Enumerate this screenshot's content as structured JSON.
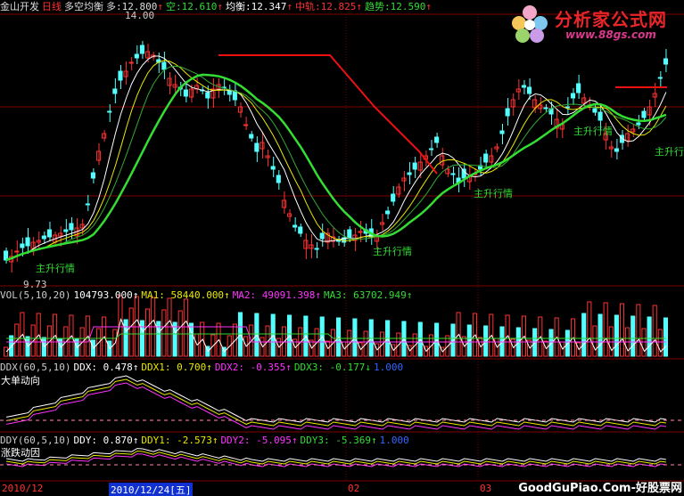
{
  "header": {
    "stock_name": "金山开发",
    "period": "日线",
    "indicator": "多空均衡",
    "bull_label": "多:",
    "bull_value": "12.800",
    "bear_label": "空:",
    "bear_value": "12.610",
    "balance_label": "均衡:",
    "balance_value": "12.347",
    "mid_label": "中轨:",
    "mid_value": "12.825",
    "trend_label": "趋势:",
    "trend_value": "12.590",
    "up_arrow": "↑"
  },
  "main_chart": {
    "high_price": "14.00",
    "low_price": "9.73",
    "annotations": [
      "主升行情",
      "主升行情",
      "主升行情",
      "主升行情",
      "主升行情"
    ]
  },
  "vol_panel": {
    "title": "VOL(5,10,20)",
    "value": "104793.000↑",
    "ma1": "MA1: 58440.000↑",
    "ma2": "MA2: 49091.398↑",
    "ma3": "MA3: 63702.949↑"
  },
  "ddx_panel": {
    "title": "DDX(60,5,10)",
    "ddx": "DDX: 0.478↑",
    "ddx1": "DDX1: 0.700↑",
    "ddx2": "DDX2: -0.355↑",
    "ddx3": "DDX3: -0.177↓",
    "ref": "1.000",
    "subtitle": "大单动向"
  },
  "ddy_panel": {
    "title": "DDY(60,5,10)",
    "ddy": "DDY: 0.870↑",
    "ddy1": "DDY1: -2.573↑",
    "ddy2": "DDY2: -5.095↑",
    "ddy3": "DDY3: -5.369↑",
    "ref": "1.000",
    "subtitle": "涨跌动因"
  },
  "date_axis": {
    "left_date": "2010/12",
    "selected_date": "2010/12/24[五]",
    "month_02": "02",
    "month_03": "03"
  },
  "watermark": {
    "logo_title": "分析家公式网",
    "logo_url": "www.88gs.com",
    "footer": "GoodGuPiao.Com-好股票网"
  },
  "colors": {
    "up": "#ff3232",
    "down": "#54ffff",
    "ma_white": "#ffffff",
    "ma_yellow": "#e8e800",
    "ma_magenta": "#ff33ff",
    "trend_green": "#33dd33",
    "trend_red": "#ee1111",
    "grid": "#800000"
  }
}
